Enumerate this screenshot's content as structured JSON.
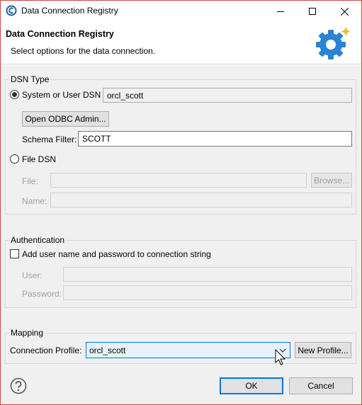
{
  "window": {
    "title": "Data Connection Registry",
    "minimize_icon": "minimize-icon",
    "maximize_icon": "maximize-icon",
    "close_icon": "close-icon"
  },
  "header": {
    "title": "Data Connection Registry",
    "subtitle": "Select options for the data connection.",
    "icon": "gear-sparkle-icon"
  },
  "dsn_type": {
    "group_label": "DSN Type",
    "system_user_dsn_label": "System or User DSN",
    "system_user_dsn_value": "orcl_scott",
    "system_user_dsn_selected": true,
    "open_odbc_admin_label": "Open ODBC Admin...",
    "schema_filter_label": "Schema Filter:",
    "schema_filter_value": "SCOTT",
    "file_dsn_label": "File DSN",
    "file_dsn_selected": false,
    "file_label": "File:",
    "file_value": "",
    "browse_label": "Browse...",
    "name_label": "Name:",
    "name_value": ""
  },
  "authentication": {
    "group_label": "Authentication",
    "add_credentials_label": "Add user name and password to connection string",
    "add_credentials_checked": false,
    "user_label": "User:",
    "user_value": "",
    "password_label": "Password:",
    "password_value": ""
  },
  "mapping": {
    "group_label": "Mapping",
    "connection_profile_label": "Connection Profile:",
    "connection_profile_value": "orcl_scott",
    "new_profile_label": "New Profile..."
  },
  "footer": {
    "help_icon": "help-icon",
    "ok_label": "OK",
    "cancel_label": "Cancel"
  },
  "colors": {
    "accent": "#0078d7",
    "gear_blue": "#2a84d2",
    "frame_border": "#c94f3d"
  }
}
